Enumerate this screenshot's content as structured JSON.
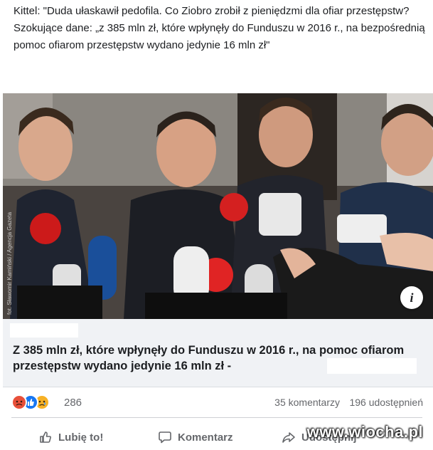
{
  "post": {
    "text": "Kittel: \"Duda ułaskawił pedofila. Co Ziobro zrobił z pieniędzmi dla ofiar przestępstw? Szokujące dane: „z 385 mln zł, które wpłynęły do Funduszu w 2016 r., na bezpośrednią pomoc ofiarom przestępstw wydano jedynie 16 mln zł\""
  },
  "photo": {
    "credit": "fot. Sławomir Kamiński / Agencja Gazeta",
    "info_icon_text": "i"
  },
  "link_card": {
    "title": "Z 385 mln zł, które wpłynęły do Funduszu w 2016 r., na pomoc ofiarom przestępstw wydano jedynie 16 mln zł -"
  },
  "stats": {
    "reaction_count": "286",
    "comments": "35 komentarzy",
    "shares": "196 udostępnień",
    "reactions": [
      "angry-icon",
      "like-icon",
      "sad-icon"
    ]
  },
  "actions": {
    "like_label": "Lubię to!",
    "comment_label": "Komentarz",
    "share_label": "Udostępnij"
  },
  "watermark": "www.wiocha.pl",
  "colors": {
    "link_card_bg": "#f0f2f5",
    "secondary_text": "#65676b",
    "like_blue": "#1877f2"
  }
}
